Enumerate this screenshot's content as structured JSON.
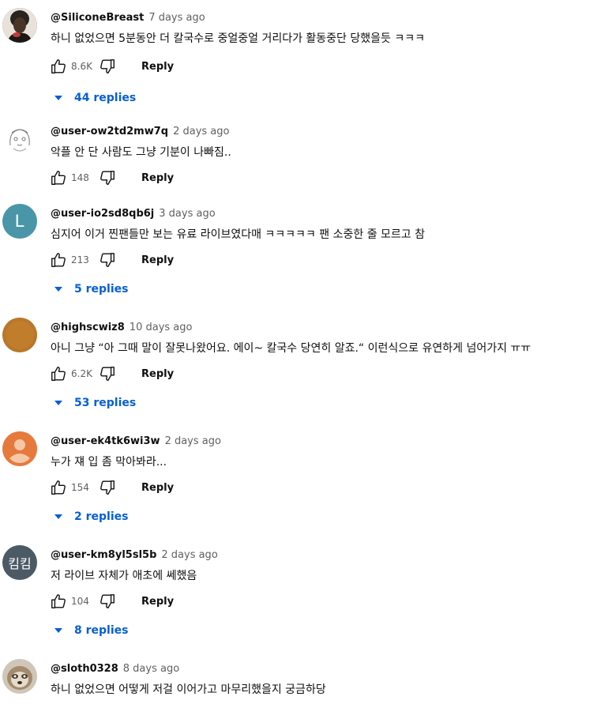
{
  "comments": [
    {
      "author": "@SiliconeBreast",
      "time": "7 days ago",
      "text": "하니 없었으면 5분동안 더 칼국수로 중얼중얼 거리다가 활동중단 당했을듯 ㅋㅋㅋ",
      "likes": "8.6K",
      "reply": "Reply",
      "replies": "44 replies"
    },
    {
      "author": "@user-ow2td2mw7q",
      "time": "2 days ago",
      "text": "악플 안 단 사람도 그냥 기분이 나빠짐..",
      "likes": "148",
      "reply": "Reply"
    },
    {
      "author": "@user-io2sd8qb6j",
      "time": "3 days ago",
      "text": "심지어 이거 찐팬들만 보는 유료 라이브였다매 ㅋㅋㅋㅋㅋ 팬 소중한 줄 모르고 참",
      "likes": "213",
      "reply": "Reply",
      "replies": "5 replies",
      "avatar_letter": "L",
      "avatar_color": "#4a96a8"
    },
    {
      "author": "@highscwiz8",
      "time": "10 days ago",
      "text": "아니 그냥 “아 그때 말이 잘못나왔어요. 에이~ 칼국수 당연히 알죠.“ 이런식으로 유연하게 넘어가지 ㅠㅠ",
      "likes": "6.2K",
      "reply": "Reply",
      "replies": "53 replies",
      "avatar_color": "#b9772a"
    },
    {
      "author": "@user-ek4tk6wi3w",
      "time": "2 days ago",
      "text": "누가 쟤 입 좀 막아봐라...",
      "likes": "154",
      "reply": "Reply",
      "replies": "2 replies",
      "avatar_color": "#e67a3c"
    },
    {
      "author": "@user-km8yl5sl5b",
      "time": "2 days ago",
      "text": "저 라이브 자체가 애초에 쎄했음",
      "likes": "104",
      "reply": "Reply",
      "replies": "8 replies",
      "avatar_letter": "킴킴",
      "avatar_color": "#4c5a66"
    },
    {
      "author": "@sloth0328",
      "time": "8 days ago",
      "text": "하니 없었으면 어떻게 저걸 이어가고 마무리했을지 궁금하당"
    }
  ],
  "colors": {
    "link": "#065fd4",
    "meta": "#606060",
    "text": "#0f0f0f"
  }
}
